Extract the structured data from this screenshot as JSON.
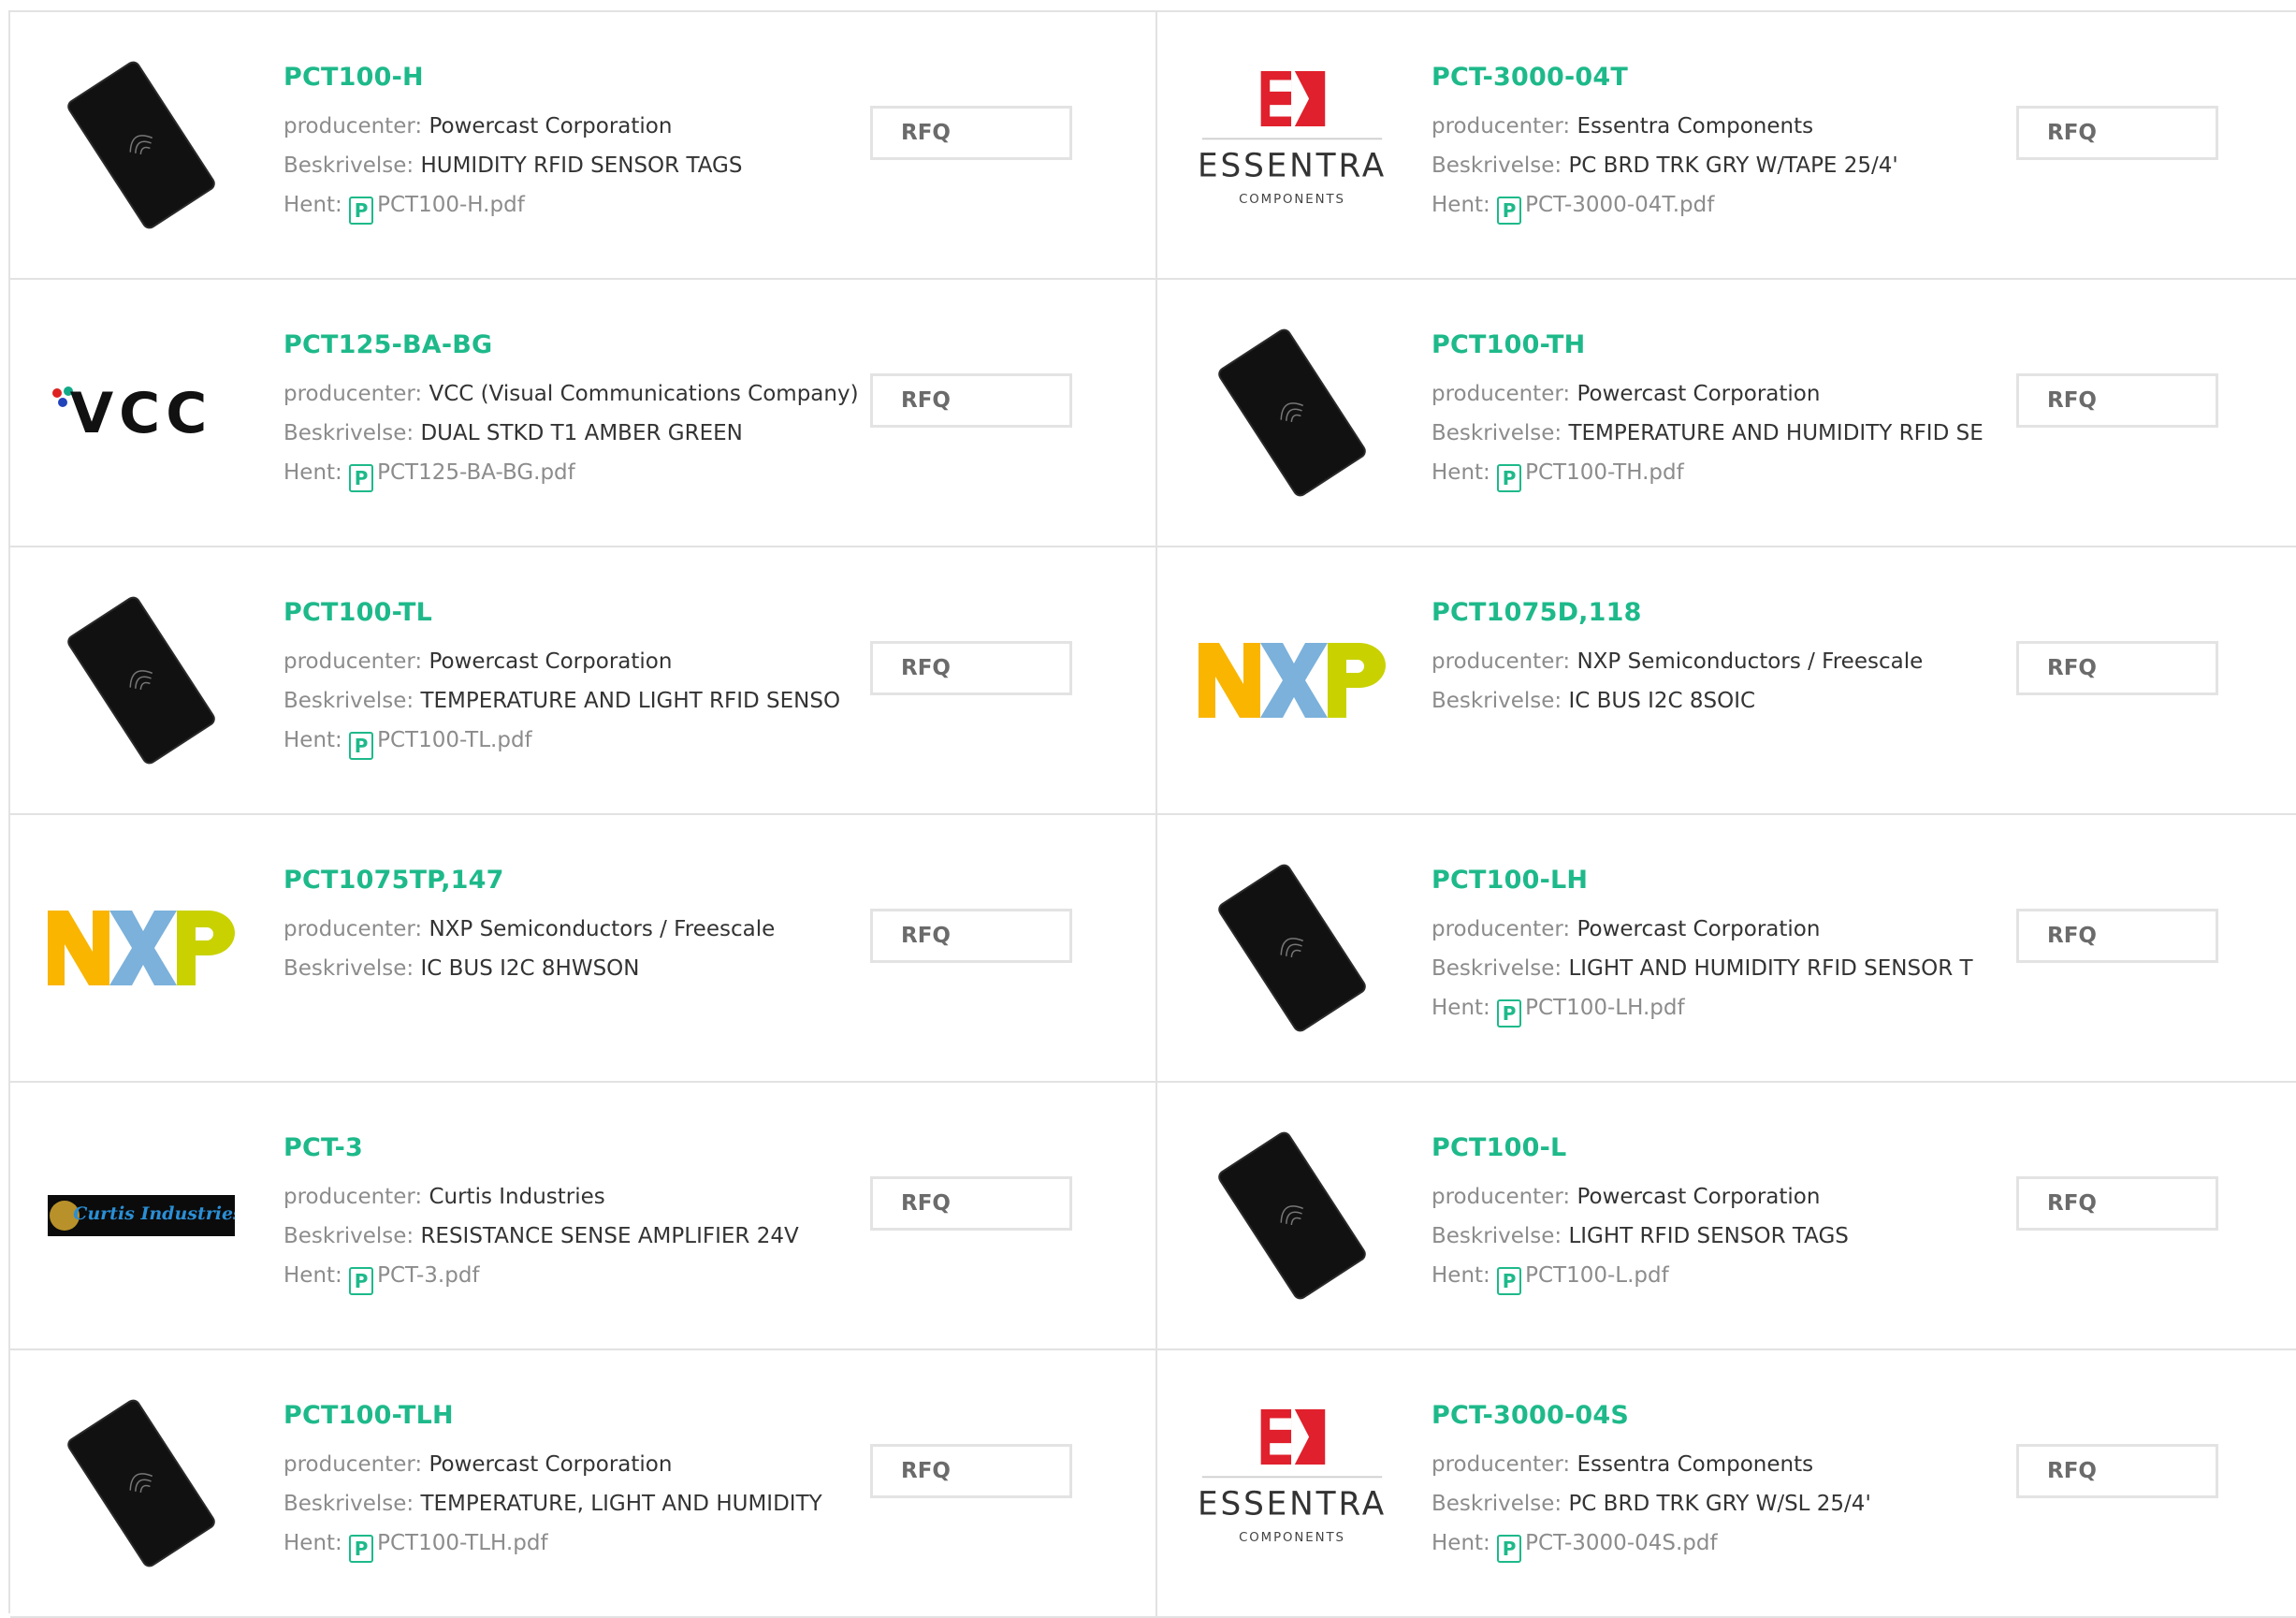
{
  "labels": {
    "manufacturer": "producenter:",
    "description": "Beskrivelse:",
    "download": "Hent:",
    "rfq": "RFQ",
    "pdf_icon": "P"
  },
  "colors": {
    "accent": "#1eb98a",
    "border": "#e2e2e2",
    "label": "#8c8c8c"
  },
  "products": [
    {
      "part": "PCT100-H",
      "manufacturer": "Powercast Corporation",
      "description": "HUMIDITY RFID SENSOR TAGS",
      "pdf": "PCT100-H.pdf",
      "image": "rfid-card-icon"
    },
    {
      "part": "PCT-3000-04T",
      "manufacturer": "Essentra Components",
      "description": "PC BRD TRK GRY W/TAPE 25/4'",
      "pdf": "PCT-3000-04T.pdf",
      "image": "essentra-logo",
      "logo_text": "ESSENTRA",
      "logo_sub": "COMPONENTS"
    },
    {
      "part": "PCT125-BA-BG",
      "manufacturer": "VCC (Visual Communications Company)",
      "description": "DUAL STKD T1 AMBER GREEN",
      "pdf": "PCT125-BA-BG.pdf",
      "image": "vcc-logo",
      "logo_text": "VCC"
    },
    {
      "part": "PCT100-TH",
      "manufacturer": "Powercast Corporation",
      "description": "TEMPERATURE AND HUMIDITY RFID SE",
      "pdf": "PCT100-TH.pdf",
      "image": "rfid-card-icon"
    },
    {
      "part": "PCT100-TL",
      "manufacturer": "Powercast Corporation",
      "description": "TEMPERATURE AND LIGHT RFID SENSO",
      "pdf": "PCT100-TL.pdf",
      "image": "rfid-card-icon"
    },
    {
      "part": "PCT1075D,118",
      "manufacturer": "NXP Semiconductors / Freescale",
      "description": "IC BUS I2C 8SOIC",
      "pdf": "",
      "image": "nxp-logo"
    },
    {
      "part": "PCT1075TP,147",
      "manufacturer": "NXP Semiconductors / Freescale",
      "description": "IC BUS I2C 8HWSON",
      "pdf": "",
      "image": "nxp-logo"
    },
    {
      "part": "PCT100-LH",
      "manufacturer": "Powercast Corporation",
      "description": "LIGHT AND HUMIDITY RFID SENSOR T",
      "pdf": "PCT100-LH.pdf",
      "image": "rfid-card-icon"
    },
    {
      "part": "PCT-3",
      "manufacturer": "Curtis Industries",
      "description": "RESISTANCE SENSE AMPLIFIER 24V",
      "pdf": "PCT-3.pdf",
      "image": "curtis-logo",
      "logo_text": "Curtis Industries"
    },
    {
      "part": "PCT100-L",
      "manufacturer": "Powercast Corporation",
      "description": "LIGHT RFID SENSOR TAGS",
      "pdf": "PCT100-L.pdf",
      "image": "rfid-card-icon"
    },
    {
      "part": "PCT100-TLH",
      "manufacturer": "Powercast Corporation",
      "description": "TEMPERATURE, LIGHT AND HUMIDITY",
      "pdf": "PCT100-TLH.pdf",
      "image": "rfid-card-icon"
    },
    {
      "part": "PCT-3000-04S",
      "manufacturer": "Essentra Components",
      "description": "PC BRD TRK GRY W/SL 25/4'",
      "pdf": "PCT-3000-04S.pdf",
      "image": "essentra-logo",
      "logo_text": "ESSENTRA",
      "logo_sub": "COMPONENTS"
    }
  ]
}
